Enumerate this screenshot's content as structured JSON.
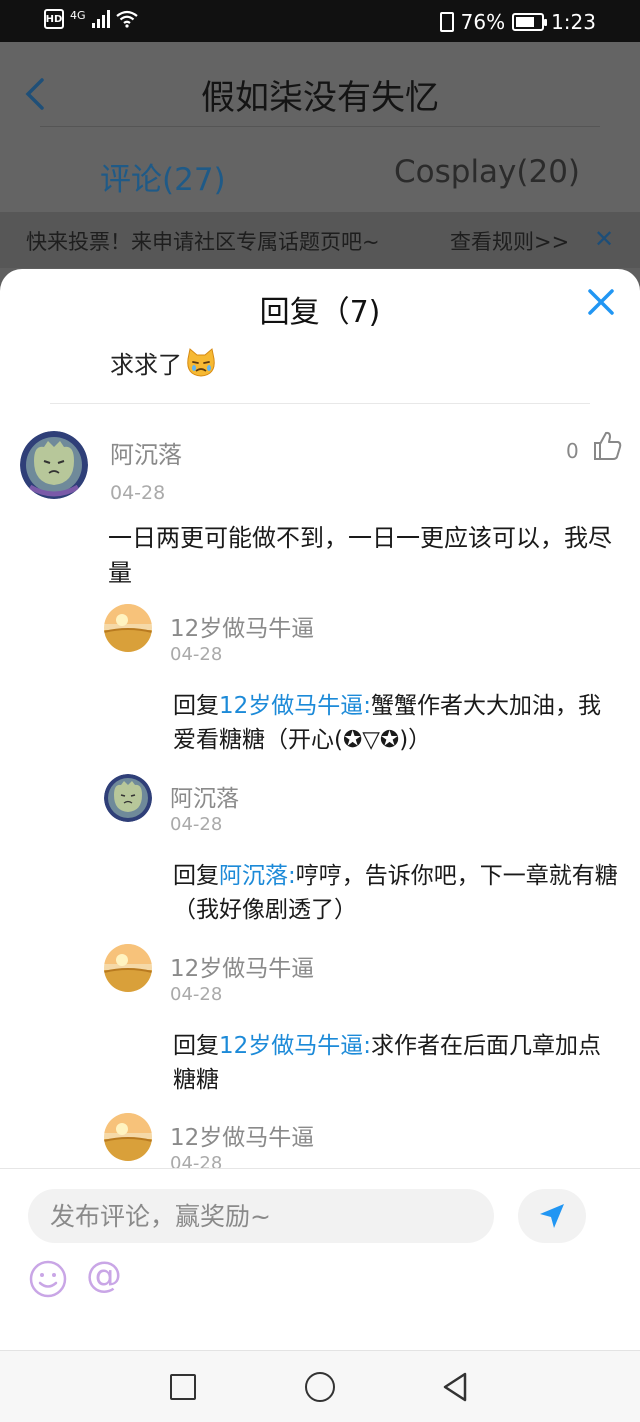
{
  "status": {
    "hd": "HD",
    "network": "4G",
    "battery": "76%",
    "time": "1:23"
  },
  "header": {
    "title": "假如柒没有失忆",
    "tabs": [
      {
        "label": "评论(27)"
      },
      {
        "label": "Cosplay(20)"
      }
    ]
  },
  "banner": {
    "text": "快来投票！来申请社区专属话题页吧~",
    "rule": "查看规则>>",
    "close": "✕"
  },
  "sheet": {
    "title": "回复（7)",
    "quoted_text": "求求了"
  },
  "main_comment": {
    "author": "阿沉落",
    "date": "04-28",
    "likes": "0",
    "body": "一日两更可能做不到，一日一更应该可以，我尽量"
  },
  "replies": [
    {
      "author": "12岁做马牛逼",
      "date": "04-28",
      "prefix": "回复",
      "mention": "12岁做马牛逼:",
      "text": "蟹蟹作者大大加油，我爱看糖糖（开心(✪▽✪)）"
    },
    {
      "author": "阿沉落",
      "date": "04-28",
      "prefix": "回复",
      "mention": "阿沉落:",
      "text": "哼哼，告诉你吧，下一章就有糖（我好像剧透了）"
    },
    {
      "author": "12岁做马牛逼",
      "date": "04-28",
      "prefix": "回复",
      "mention": "12岁做马牛逼:",
      "text": "求作者在后面几章加点糖糖"
    },
    {
      "author": "12岁做马牛逼",
      "date": "04-28"
    }
  ],
  "input": {
    "placeholder": "发布评论，赢奖励~",
    "at": "@"
  },
  "colors": {
    "accent": "#1c8ad8",
    "mention": "#1c8ad8",
    "close_icon": "#2196f3"
  }
}
